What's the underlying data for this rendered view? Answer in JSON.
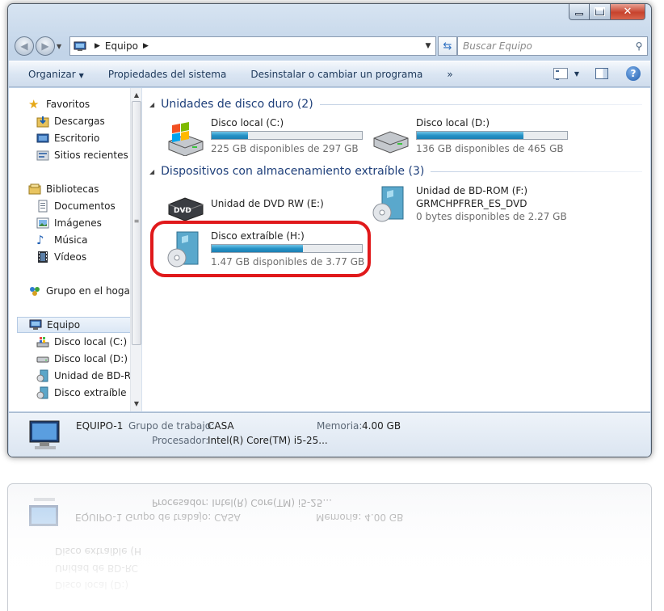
{
  "window": {
    "title_buttons": [
      "minimize",
      "maximize",
      "close"
    ]
  },
  "address": {
    "path": "Equipo",
    "search_placeholder": "Buscar Equipo"
  },
  "toolbar": {
    "organize": "Organizar",
    "system_properties": "Propiedades del sistema",
    "uninstall": "Desinstalar o cambiar un programa",
    "more": "»"
  },
  "nav": {
    "favorites": "Favoritos",
    "downloads": "Descargas",
    "desktop": "Escritorio",
    "recent": "Sitios recientes",
    "libraries": "Bibliotecas",
    "documents": "Documentos",
    "images": "Imágenes",
    "music": "Música",
    "videos": "Vídeos",
    "homegroup": "Grupo en el hogar",
    "computer": "Equipo",
    "drive_c": "Disco local (C:)",
    "drive_d": "Disco local (D:)",
    "drive_f": "Unidad de BD-RC",
    "drive_h": "Disco extraíble (H"
  },
  "groups": {
    "hard_disks": "Unidades de disco duro (2)",
    "removable": "Dispositivos con almacenamiento extraíble (3)"
  },
  "drives": {
    "c": {
      "name": "Disco local (C:)",
      "free": "225 GB disponibles de 297 GB",
      "used_fraction": 0.24
    },
    "d": {
      "name": "Disco local (D:)",
      "free": "136 GB disponibles de 465 GB",
      "used_fraction": 0.71
    },
    "e": {
      "name": "Unidad de DVD RW (E:)"
    },
    "f": {
      "name": "Unidad de BD-ROM (F:)",
      "label": "GRMCHPFRER_ES_DVD",
      "free": "0 bytes disponibles de 2.27 GB"
    },
    "h": {
      "name": "Disco extraíble (H:)",
      "free": "1.47 GB disponibles de 3.77 GB",
      "used_fraction": 0.61
    }
  },
  "details": {
    "computer_name": "EQUIPO-1",
    "workgroup_label": "Grupo de trabajo:",
    "workgroup": "CASA",
    "memory_label": "Memoria:",
    "memory": "4.00 GB",
    "processor_label": "Procesador:",
    "processor": "Intel(R) Core(TM) i5-25..."
  },
  "colors": {
    "accent": "#1e3f7a",
    "drive_bar": "#2693c7",
    "highlight": "#e0191b"
  }
}
